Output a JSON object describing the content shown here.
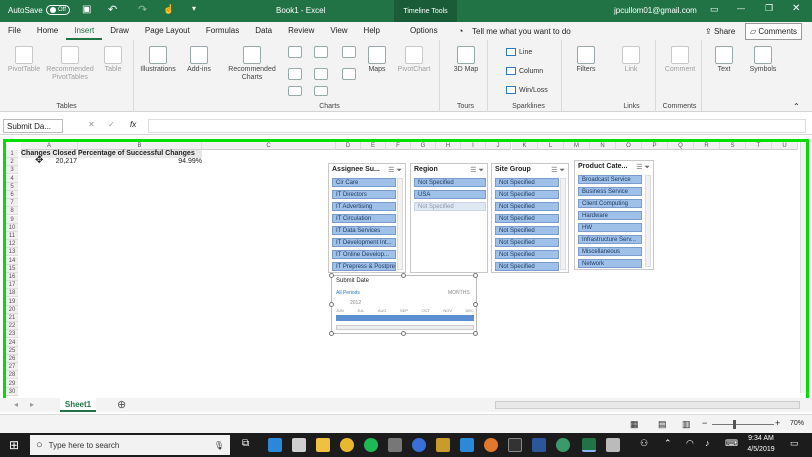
{
  "titlebar": {
    "autosave_label": "AutoSave",
    "autosave_state": "Off",
    "title": "Book1 - Excel",
    "contextual_tab": "Timeline Tools",
    "user_email": "jpcullom01@gmail.com"
  },
  "menu": {
    "tabs": [
      "File",
      "Home",
      "Insert",
      "Draw",
      "Page Layout",
      "Formulas",
      "Data",
      "Review",
      "View",
      "Help",
      "Options"
    ],
    "active_tab": "Insert",
    "tell_me": "Tell me what you want to do",
    "share": "Share",
    "comments": "Comments"
  },
  "ribbon": {
    "tables": {
      "label": "Tables",
      "pivottable": "PivotTable",
      "recommended_pivottables": "Recommended PivotTables",
      "table": "Table"
    },
    "illustrations": "Illustrations",
    "addins": "Add-ins",
    "charts": {
      "label": "Charts",
      "recommended": "Recommended Charts",
      "maps": "Maps",
      "pivotchart": "PivotChart"
    },
    "tours": {
      "label": "Tours",
      "map3d": "3D Map"
    },
    "sparklines": {
      "label": "Sparklines",
      "line": "Line",
      "column": "Column",
      "winloss": "Win/Loss"
    },
    "filters": {
      "filters": "Filters"
    },
    "links": {
      "label": "Links",
      "link": "Link"
    },
    "comments_group": {
      "label": "Comments",
      "comment": "Comment"
    },
    "text": "Text",
    "symbols": "Symbols"
  },
  "formula_bar": {
    "namebox": "Submit Da...",
    "fx": "fx",
    "value": ""
  },
  "columns": [
    "A",
    "B",
    "C",
    "D",
    "E",
    "F",
    "G",
    "H",
    "I",
    "J",
    "K",
    "L",
    "M",
    "N",
    "O",
    "P",
    "Q",
    "R",
    "S",
    "T",
    "U"
  ],
  "rows": [
    "1",
    "2",
    "3",
    "4",
    "5",
    "6",
    "7",
    "8",
    "9",
    "10",
    "11",
    "12",
    "13",
    "14",
    "15",
    "16",
    "17",
    "18",
    "19",
    "20",
    "21",
    "22",
    "23",
    "24",
    "25",
    "26",
    "27",
    "28",
    "29",
    "30"
  ],
  "cells": {
    "a1": "Changes Closed",
    "b1": "Percentage of Successful Changes",
    "a2": "20,217",
    "b2": "94.99%"
  },
  "slicers": {
    "assignee": {
      "title": "Assignee Su...",
      "items": [
        "Cir Care",
        "IT Directors",
        "IT Advertising",
        "IT Circulation",
        "IT Data Services",
        "IT Development Int...",
        "IT Online Develop...",
        "IT Prepress & Postpress"
      ]
    },
    "region": {
      "title": "Region",
      "items": [
        "Not Specified",
        "USA",
        "Not Specified"
      ]
    },
    "site": {
      "title": "Site Group",
      "items": [
        "Not Specified",
        "Not Specified",
        "Not Specified",
        "Not Specified",
        "Not Specified",
        "Not Specified",
        "Not Specified",
        "Not Specified"
      ]
    },
    "product": {
      "title": "Product Cate...",
      "items": [
        "Broadcast Service",
        "Business Service",
        "Client Computing",
        "Hardware",
        "HW",
        "Infrastructure Serv...",
        "Miscellaneous",
        "Network"
      ]
    }
  },
  "timeline": {
    "title": "Submit Date",
    "period": "All Periods",
    "unit": "MONTHS",
    "year": "2012",
    "months": [
      "JUN",
      "JUL",
      "AUG",
      "SEP",
      "OCT",
      "NOV",
      "DEC"
    ]
  },
  "sheet_tab": "Sheet1",
  "status": {
    "zoom": "70%"
  },
  "taskbar": {
    "search": "Type here to search",
    "time": "9:34 AM",
    "date": "4/5/2019"
  }
}
